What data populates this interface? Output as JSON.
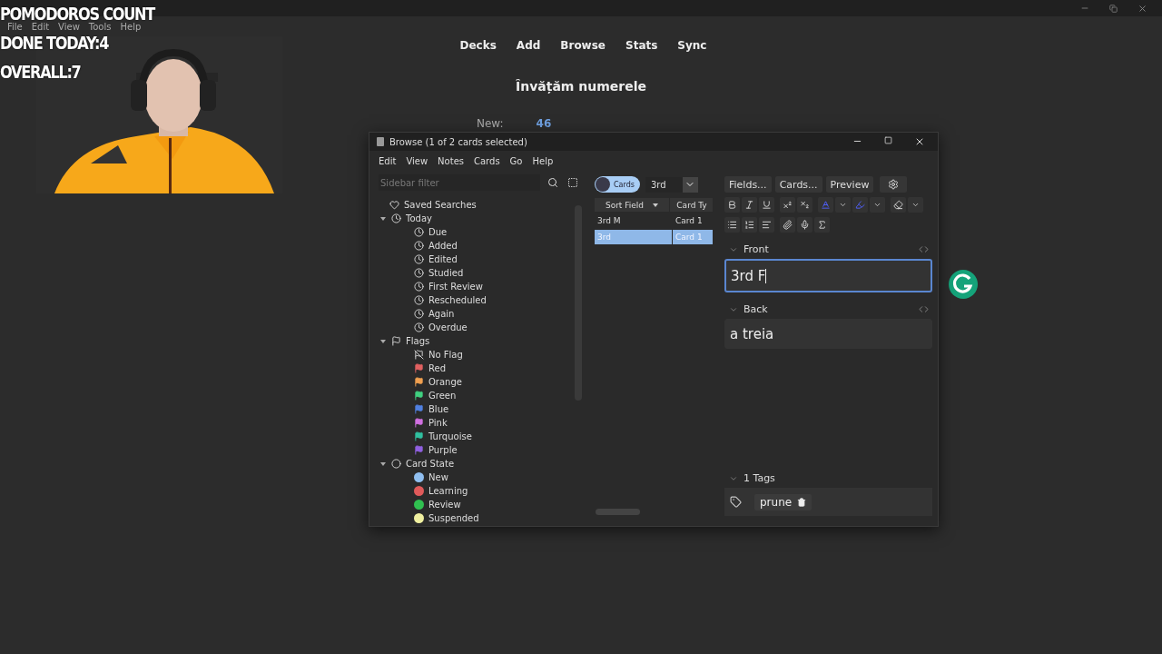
{
  "overlay": {
    "lines": [
      "POMODOROS COUNT",
      "DONE TODAY:4",
      "OVERALL:7"
    ]
  },
  "main": {
    "menu": [
      "File",
      "Edit",
      "View",
      "Tools",
      "Help"
    ],
    "toolbar": [
      "Decks",
      "Add",
      "Browse",
      "Stats",
      "Sync"
    ],
    "deck_title": "Învățăm numerele",
    "stats": [
      {
        "label": "New:",
        "value": "46"
      }
    ]
  },
  "browse": {
    "title": "Browse (1 of 2 cards selected)",
    "menu": [
      "Edit",
      "View",
      "Notes",
      "Cards",
      "Go",
      "Help"
    ],
    "sidebar": {
      "placeholder": "Sidebar filter",
      "items": [
        {
          "label": "Saved Searches",
          "kind": "heart"
        },
        {
          "label": "Today",
          "kind": "clock",
          "expanded": true,
          "children": [
            {
              "label": "Due",
              "kind": "clock"
            },
            {
              "label": "Added",
              "kind": "clock"
            },
            {
              "label": "Edited",
              "kind": "clock"
            },
            {
              "label": "Studied",
              "kind": "clock"
            },
            {
              "label": "First Review",
              "kind": "clock"
            },
            {
              "label": "Rescheduled",
              "kind": "clock"
            },
            {
              "label": "Again",
              "kind": "clock"
            },
            {
              "label": "Overdue",
              "kind": "clock"
            }
          ]
        },
        {
          "label": "Flags",
          "kind": "flag",
          "expanded": true,
          "children": [
            {
              "label": "No Flag",
              "kind": "noflag"
            },
            {
              "label": "Red",
              "kind": "flag",
              "color": "#e06060"
            },
            {
              "label": "Orange",
              "kind": "flag",
              "color": "#f0a050"
            },
            {
              "label": "Green",
              "kind": "flag",
              "color": "#40d080"
            },
            {
              "label": "Blue",
              "kind": "flag",
              "color": "#5080e0"
            },
            {
              "label": "Pink",
              "kind": "flag",
              "color": "#d070e0"
            },
            {
              "label": "Turquoise",
              "kind": "flag",
              "color": "#30c0a0"
            },
            {
              "label": "Purple",
              "kind": "flag",
              "color": "#9060e0"
            }
          ]
        },
        {
          "label": "Card State",
          "kind": "circle",
          "expanded": true,
          "children": [
            {
              "label": "New",
              "kind": "dot",
              "color": "#90bff0"
            },
            {
              "label": "Learning",
              "kind": "dot",
              "color": "#e05a5a"
            },
            {
              "label": "Review",
              "kind": "dot",
              "color": "#30c050"
            },
            {
              "label": "Suspended",
              "kind": "dot",
              "color": "#f0f0a0"
            }
          ]
        }
      ]
    },
    "switch": {
      "label": "Cards",
      "selected": true
    },
    "search": {
      "value": "3rd"
    },
    "columns": [
      "Sort Field",
      "Card Ty"
    ],
    "rows": [
      {
        "cells": [
          "3rd M",
          "Card 1"
        ],
        "selected": false
      },
      {
        "cells": [
          "3rd",
          "Card 1"
        ],
        "selected": true
      }
    ],
    "editor_buttons": [
      "Fields...",
      "Cards...",
      "Preview"
    ],
    "fields": [
      {
        "name": "Front",
        "value": "3rd F",
        "focused": true
      },
      {
        "name": "Back",
        "value": "a treia",
        "focused": false
      }
    ],
    "tags": {
      "heading": "1 Tags",
      "items": [
        "prune"
      ]
    }
  }
}
